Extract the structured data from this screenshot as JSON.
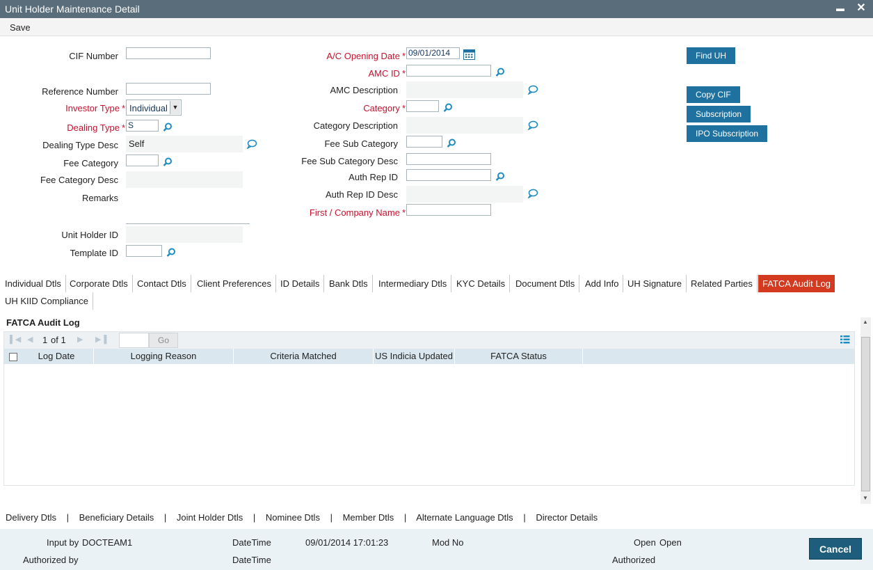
{
  "window": {
    "title": "Unit Holder Maintenance Detail",
    "minimize": "▬",
    "close": "✕"
  },
  "menu": {
    "save": "Save"
  },
  "form": {
    "cif_number_label": "CIF Number",
    "reference_number_label": "Reference Number",
    "investor_type_label": "Investor Type",
    "investor_type_value": "Individual",
    "dealing_type_label": "Dealing Type",
    "dealing_type_value": "S",
    "dealing_type_desc_label": "Dealing Type Desc",
    "dealing_type_desc_value": "Self",
    "fee_category_label": "Fee Category",
    "fee_category_desc_label": "Fee Category Desc",
    "remarks_label": "Remarks",
    "unit_holder_id_label": "Unit Holder ID",
    "template_id_label": "Template ID",
    "ac_opening_date_label": "A/C Opening Date",
    "ac_opening_date_value": "09/01/2014",
    "amc_id_label": "AMC ID",
    "amc_description_label": "AMC Description",
    "category_label": "Category",
    "category_description_label": "Category Description",
    "fee_sub_category_label": "Fee Sub Category",
    "fee_sub_category_desc_label": "Fee Sub Category Desc",
    "auth_rep_id_label": "Auth Rep ID",
    "auth_rep_id_desc_label": "Auth Rep ID Desc",
    "first_company_name_label": "First / Company Name",
    "required_marker": "*"
  },
  "actions": {
    "find_uh": "Find UH",
    "copy_cif": "Copy CIF",
    "subscription": "Subscription",
    "ipo_subscription": "IPO Subscription"
  },
  "tabs": [
    "Individual Dtls",
    "Corporate Dtls",
    "Contact Dtls",
    "Client Preferences",
    "ID Details",
    "Bank Dtls",
    "Intermediary Dtls",
    "KYC Details",
    "Document Dtls",
    "Add Info",
    "UH Signature",
    "Related Parties",
    "FATCA Audit Log",
    "UH KIID Compliance"
  ],
  "active_tab": "FATCA Audit Log",
  "audit_log": {
    "section_title": "FATCA Audit Log",
    "page_current": "1",
    "page_of": "of 1",
    "go": "Go",
    "columns": [
      "Log Date",
      "Logging Reason",
      "Criteria Matched",
      "US Indicia Updated",
      "FATCA Status"
    ]
  },
  "sub_links": [
    "Delivery Dtls",
    "Beneficiary Details",
    "Joint Holder Dtls",
    "Nominee Dtls",
    "Member Dtls",
    "Alternate Language Dtls",
    "Director Details"
  ],
  "sub_link_separator": "|",
  "footer": {
    "input_by_label": "Input by",
    "input_by_value": "DOCTEAM1",
    "datetime_label": "DateTime",
    "datetime_value": "09/01/2014 17:01:23",
    "mod_no_label": "Mod No",
    "open_label": "Open",
    "open_value": "Open",
    "authorized_by_label": "Authorized by",
    "datetime2_label": "DateTime",
    "authorized_label": "Authorized",
    "cancel": "Cancel"
  },
  "colors": {
    "titlebar": "#5a6d7a",
    "required": "#c8102e",
    "button": "#1f72a0",
    "active_tab": "#d33a1f"
  }
}
